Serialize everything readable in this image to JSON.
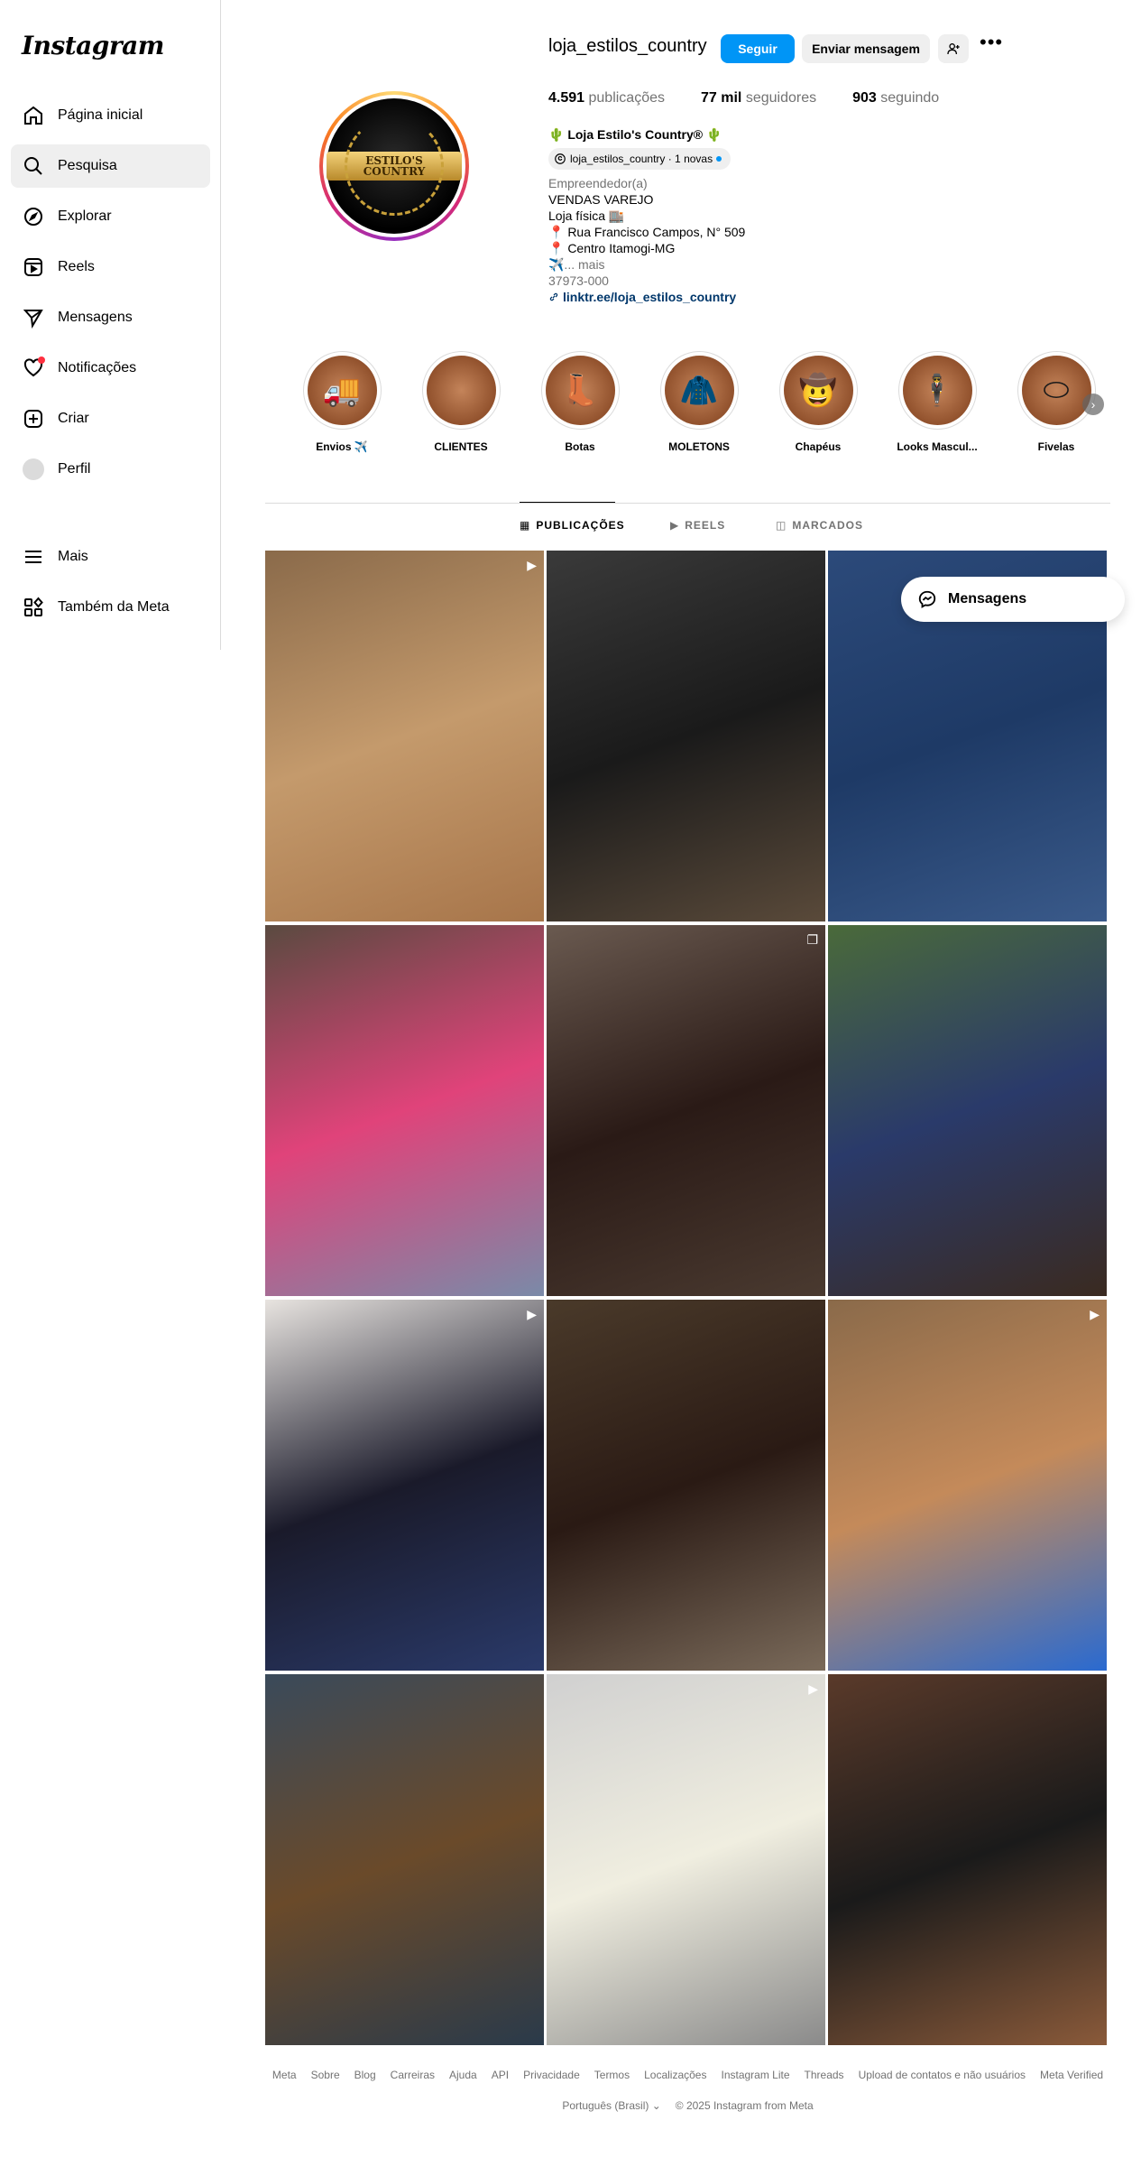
{
  "sidebar": {
    "logo": "Instagram",
    "items": [
      {
        "label": "Página inicial",
        "icon": "home-icon"
      },
      {
        "label": "Pesquisa",
        "icon": "search-icon"
      },
      {
        "label": "Explorar",
        "icon": "compass-icon"
      },
      {
        "label": "Reels",
        "icon": "reels-icon"
      },
      {
        "label": "Mensagens",
        "icon": "send-icon"
      },
      {
        "label": "Notificações",
        "icon": "heart-icon"
      },
      {
        "label": "Criar",
        "icon": "plus-square-icon"
      },
      {
        "label": "Perfil",
        "icon": "avatar"
      },
      {
        "label": "Mais",
        "icon": "menu-icon"
      },
      {
        "label": "Também da Meta",
        "icon": "meta-apps-icon"
      }
    ]
  },
  "profile": {
    "username": "loja_estilos_country",
    "follow_label": "Seguir",
    "message_label": "Enviar mensagem",
    "more_label": "•••",
    "pic_text": "ESTILO'S COUNTRY",
    "stats": [
      {
        "value": "4.591",
        "label": "publicações"
      },
      {
        "value": "77 mil",
        "label": "seguidores"
      },
      {
        "value": "903",
        "label": "seguindo"
      }
    ],
    "fullname": "🌵 Loja Estilo's Country® 🌵",
    "threads_badge": "loja_estilos_country · 1 novas",
    "category": "Empreendedor(a)",
    "bio_lines": [
      "VENDAS VAREJO",
      "Loja física 🏬",
      "📍 Rua Francisco Campos, N° 509",
      "📍 Centro Itamogi-MG",
      "✈️... mais"
    ],
    "zip": "37973-000",
    "link": "linktr.ee/loja_estilos_country"
  },
  "highlights": [
    {
      "label": "Envios ✈️",
      "icon": "🚚"
    },
    {
      "label": "CLIENTES",
      "icon": ""
    },
    {
      "label": "Botas",
      "icon": "👢"
    },
    {
      "label": "MOLETONS",
      "icon": "🧥"
    },
    {
      "label": "Chapéus",
      "icon": "🤠"
    },
    {
      "label": "Looks Mascul...",
      "icon": "🕴"
    },
    {
      "label": "Fivelas",
      "icon": "⬭"
    }
  ],
  "tabs": [
    {
      "label": "PUBLICAÇÕES",
      "icon": "▦"
    },
    {
      "label": "REELS",
      "icon": "▶"
    },
    {
      "label": "MARCADOS",
      "icon": "◫"
    }
  ],
  "posts": [
    {
      "type": "reel",
      "icon": "▶",
      "colors": [
        "#8a6a4a",
        "#c49a6c",
        "#a7754a"
      ]
    },
    {
      "type": "photo",
      "icon": "",
      "colors": [
        "#3a3a3a",
        "#1a1a1a",
        "#5a4a3a"
      ]
    },
    {
      "type": "photo",
      "icon": "",
      "colors": [
        "#2c4a7a",
        "#1e3a66",
        "#3a5a8a"
      ]
    },
    {
      "type": "photo",
      "icon": "",
      "colors": [
        "#5a4a40",
        "#e0437a",
        "#7a8aa8"
      ]
    },
    {
      "type": "carousel",
      "icon": "❐",
      "colors": [
        "#6a5a50",
        "#2a1a16",
        "#4a3a30"
      ]
    },
    {
      "type": "photo",
      "icon": "",
      "colors": [
        "#4a6a3a",
        "#2a3a6a",
        "#3a2a20"
      ]
    },
    {
      "type": "reel",
      "icon": "▶",
      "colors": [
        "#e8e4e0",
        "#1a1a2a",
        "#2a3a6a"
      ]
    },
    {
      "type": "photo",
      "icon": "",
      "colors": [
        "#4a3a2a",
        "#2a1a14",
        "#7a6a5a"
      ]
    },
    {
      "type": "reel",
      "icon": "▶",
      "colors": [
        "#8a6a4a",
        "#c48a5a",
        "#2a6ad0"
      ]
    },
    {
      "type": "photo",
      "icon": "",
      "colors": [
        "#3a4a5a",
        "#6a4a2a",
        "#2a3a4a"
      ]
    },
    {
      "type": "reel",
      "icon": "▶",
      "colors": [
        "#d0d0d0",
        "#f0eee0",
        "#8a8a8a"
      ]
    },
    {
      "type": "photo",
      "icon": "",
      "colors": [
        "#5a3a2a",
        "#1a1a1a",
        "#8a5a3a"
      ]
    }
  ],
  "messages_float": "Mensagens",
  "footer": {
    "links": [
      "Meta",
      "Sobre",
      "Blog",
      "Carreiras",
      "Ajuda",
      "API",
      "Privacidade",
      "Termos",
      "Localizações",
      "Instagram Lite",
      "Threads",
      "Upload de contatos e não usuários",
      "Meta Verified"
    ],
    "language": "Português (Brasil)",
    "copyright": "© 2025 Instagram from Meta"
  }
}
